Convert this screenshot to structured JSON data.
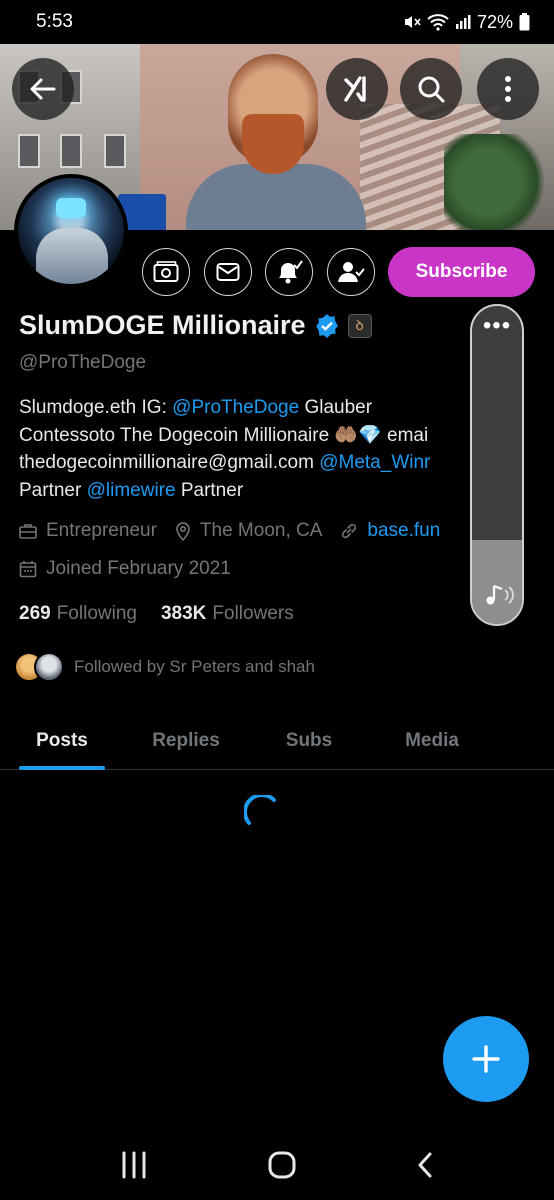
{
  "status_bar": {
    "time": "5:53",
    "battery": "72%"
  },
  "header": {
    "back_icon": "arrow-left-icon",
    "grok_icon": "grok-icon",
    "search_icon": "search-icon",
    "more_icon": "more-vertical-icon"
  },
  "profile": {
    "name": "SlumDOGE Millionaire",
    "handle": "@ProTheDoge",
    "bio_lines": [
      {
        "parts": [
          {
            "t": "Slumdoge.eth IG: "
          },
          {
            "t": "@ProTheDoge",
            "link": true
          },
          {
            "t": " Glauber"
          }
        ]
      },
      {
        "parts": [
          {
            "t": "Contessoto The Dogecoin Millionaire 🤲🏽💎 emai"
          }
        ]
      },
      {
        "parts": [
          {
            "t": "thedogecoinmillionaire@gmail.com "
          },
          {
            "t": "@Meta_Winr",
            "link": true
          }
        ]
      },
      {
        "parts": [
          {
            "t": "Partner "
          },
          {
            "t": "@limewire",
            "link": true
          },
          {
            "t": " Partner"
          }
        ]
      }
    ],
    "profession": "Entrepreneur",
    "location": "The Moon, CA",
    "website": "base.fun",
    "joined": "Joined February 2021",
    "following_count": "269",
    "following_label": "Following",
    "followers_count": "383K",
    "followers_label": "Followers",
    "followed_by": "Followed by Sr Peters and shah"
  },
  "actions": {
    "subscribe_label": "Subscribe"
  },
  "tabs": [
    {
      "label": "Posts",
      "active": true
    },
    {
      "label": "Replies",
      "active": false
    },
    {
      "label": "Subs",
      "active": false
    },
    {
      "label": "Media",
      "active": false
    }
  ],
  "volume_panel": {
    "more_label": "•••",
    "level": 0.26
  },
  "colors": {
    "accent": "#1d9bf0",
    "subscribe": "#c936c7",
    "background": "#000000"
  }
}
